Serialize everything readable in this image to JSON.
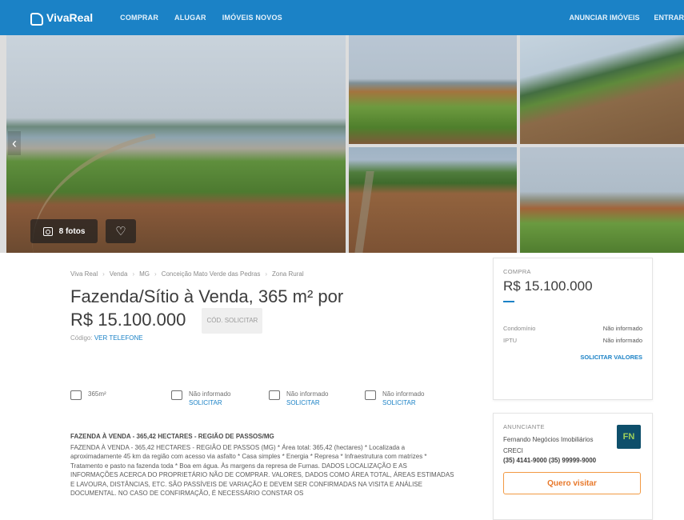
{
  "header": {
    "logo_text": "VivaReal",
    "nav": [
      "COMPRAR",
      "ALUGAR",
      "IMÓVEIS NOVOS"
    ],
    "nav_right": [
      "ANUNCIAR IMÓVEIS",
      "ENTRAR"
    ]
  },
  "gallery": {
    "photos_label": "8 fotos",
    "prev_arrow": "‹",
    "fav_icon": "♡"
  },
  "breadcrumb": [
    "Viva Real",
    "Venda",
    "MG",
    "Conceição Mato Verde das Pedras",
    "Zona Rural"
  ],
  "listing": {
    "title": "Fazenda/Sítio à Venda, 365 m² por R$ 15.100.000",
    "badge": "CÓD. SOLICITAR",
    "code_prefix": "Código:",
    "code_link": "VER TELEFONE"
  },
  "features": [
    {
      "icon": "area-icon",
      "text": "365m²",
      "link": ""
    },
    {
      "icon": "bed-icon",
      "text": "Não informado",
      "link": "SOLICITAR"
    },
    {
      "icon": "shower-icon",
      "text": "Não informado",
      "link": "SOLICITAR"
    },
    {
      "icon": "car-icon",
      "text": "Não informado",
      "link": "SOLICITAR"
    }
  ],
  "description": {
    "heading": "FAZENDA À VENDA - 365,42 HECTARES - REGIÃO DE PASSOS/MG",
    "body": "FAZENDA À VENDA - 365,42 HECTARES - REGIÃO DE PASSOS (MG) * Área total: 365,42 (hectares) * Localizada a aproximadamente 45 km da região com acesso via asfalto * Casa simples * Energia * Represa * Infraestrutura com matrizes * Tratamento e pasto na fazenda toda * Boa em água. Às margens da represa de Furnas. DADOS LOCALIZAÇÃO E AS INFORMAÇÕES ACERCA DO PROPRIETÁRIO NÃO DE COMPRAR. VALORES, DADOS COMO ÁREA TOTAL, ÁREAS ESTIMADAS E LAVOURA, DISTÂNCIAS, ETC. SÃO PASSÍVEIS DE VARIAÇÃO E DEVEM SER CONFIRMADAS NA VISITA E ANÁLISE DOCUMENTAL. NO CASO DE CONFIRMAÇÃO, É NECESSÁRIO CONSTAR OS"
  },
  "price_card": {
    "label": "COMPRA",
    "price": "R$ 15.100.000",
    "rows": [
      {
        "label": "Condomínio",
        "value": "Não informado"
      },
      {
        "label": "IPTU",
        "value": "Não informado"
      }
    ],
    "link": "SOLICITAR VALORES"
  },
  "advertiser": {
    "label": "ANUNCIANTE",
    "name": "Fernando Negócios Imobiliários",
    "creci": "CRECI",
    "phone": "(35) 4141-9000 (35) 99999-9000",
    "logo": "FN",
    "button": "Quero visitar"
  },
  "colors": {
    "brand_blue": "#1b82c6",
    "cta_orange": "#f29a43"
  }
}
